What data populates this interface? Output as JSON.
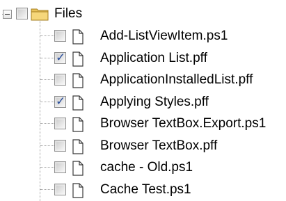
{
  "root": {
    "label": "Files",
    "icon": "folder-icon",
    "expanded": true,
    "checked": false
  },
  "items": [
    {
      "label": "Add-ListViewItem.ps1",
      "checked": false,
      "icon": "file-icon"
    },
    {
      "label": "Application List.pff",
      "checked": true,
      "icon": "file-icon"
    },
    {
      "label": "ApplicationInstalledList.pff",
      "checked": false,
      "icon": "file-icon"
    },
    {
      "label": "Applying Styles.pff",
      "checked": true,
      "icon": "file-icon"
    },
    {
      "label": "Browser TextBox.Export.ps1",
      "checked": false,
      "icon": "file-icon"
    },
    {
      "label": "Browser TextBox.pff",
      "checked": false,
      "icon": "file-icon"
    },
    {
      "label": "cache - Old.ps1",
      "checked": false,
      "icon": "file-icon"
    },
    {
      "label": "Cache Test.ps1",
      "checked": false,
      "icon": "file-icon"
    }
  ],
  "colors": {
    "checkmark": "#2a4f9c",
    "folder": "#e8c25a",
    "lines": "#a0a0a0"
  },
  "tick_glyph": "✓"
}
